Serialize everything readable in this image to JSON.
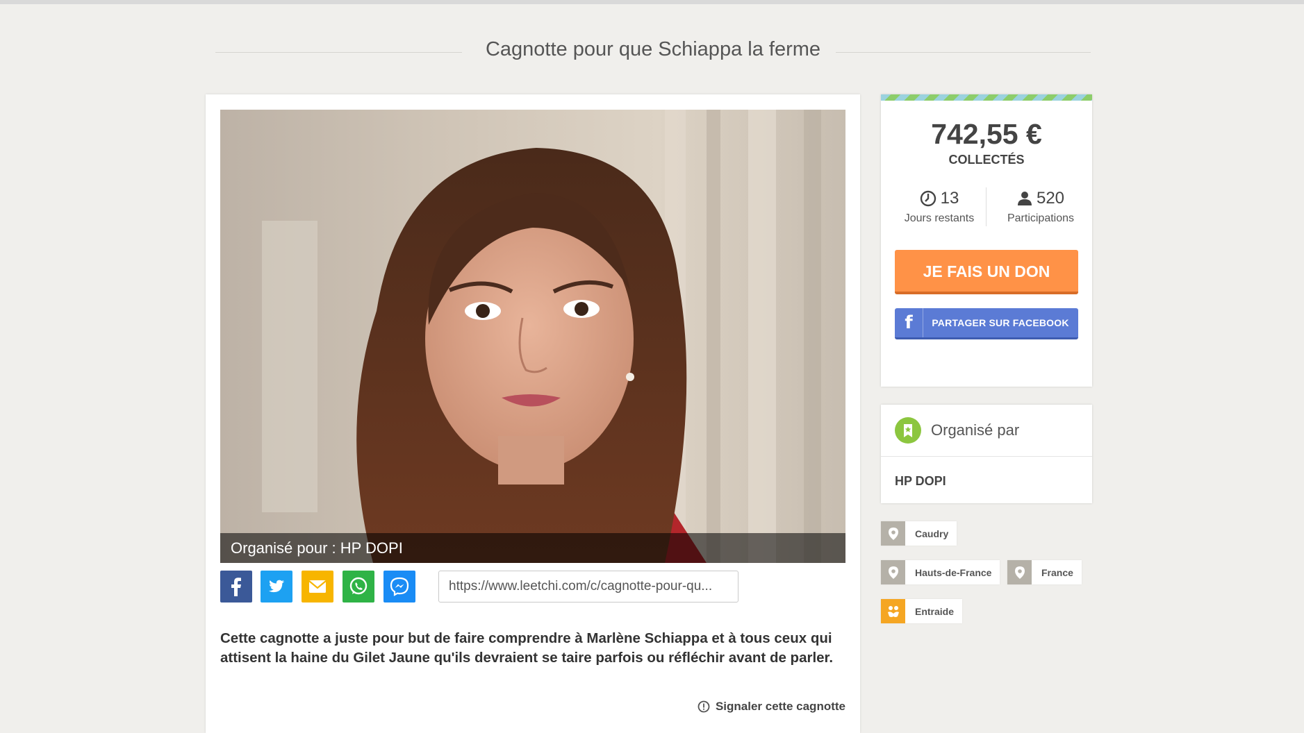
{
  "page": {
    "title": "Cagnotte pour que Schiappa la ferme"
  },
  "media": {
    "caption": "Organisé pour : HP DOPI"
  },
  "share": {
    "buttons": [
      {
        "name": "facebook",
        "icon": "facebook-icon",
        "color": "#3b5998"
      },
      {
        "name": "twitter",
        "icon": "twitter-icon",
        "color": "#1da1f2"
      },
      {
        "name": "email",
        "icon": "mail-icon",
        "color": "#f7b500"
      },
      {
        "name": "whatsapp",
        "icon": "whatsapp-icon",
        "color": "#2fb346"
      },
      {
        "name": "messenger",
        "icon": "messenger-icon",
        "color": "#1a8cf5"
      }
    ],
    "url": "https://www.leetchi.com/c/cagnotte-pour-qu..."
  },
  "description": "Cette cagnotte a juste pour but de faire comprendre à Marlène Schiappa et à tous ceux qui attisent la haine du Gilet Jaune qu'ils devraient se taire parfois ou réfléchir avant de parler.",
  "report_label": "Signaler cette cagnotte",
  "summary": {
    "amount": "742,55 €",
    "collected_label": "COLLECTÉS",
    "days_value": "13",
    "days_label": "Jours restants",
    "participants_value": "520",
    "participants_label": "Participations",
    "donate_label": "JE FAIS UN DON",
    "facebook_share_label": "PARTAGER SUR FACEBOOK",
    "facebook_letter": "f"
  },
  "organizer": {
    "heading": "Organisé par",
    "name": "HP DOPI"
  },
  "tags": [
    {
      "label": "Caudry",
      "icon": "location-pin-icon"
    },
    {
      "label": "Hauts-de-France",
      "icon": "location-pin-icon"
    },
    {
      "label": "France",
      "icon": "location-pin-icon"
    },
    {
      "label": "Entraide",
      "icon": "hands-icon"
    }
  ],
  "colors": {
    "background": "#f0efec",
    "donate": "#ff9247",
    "facebook": "#5b7bd5",
    "pin_tag": "#b5b1a8",
    "category_tag": "#f5a623",
    "organizer_badge": "#8cc63f"
  }
}
